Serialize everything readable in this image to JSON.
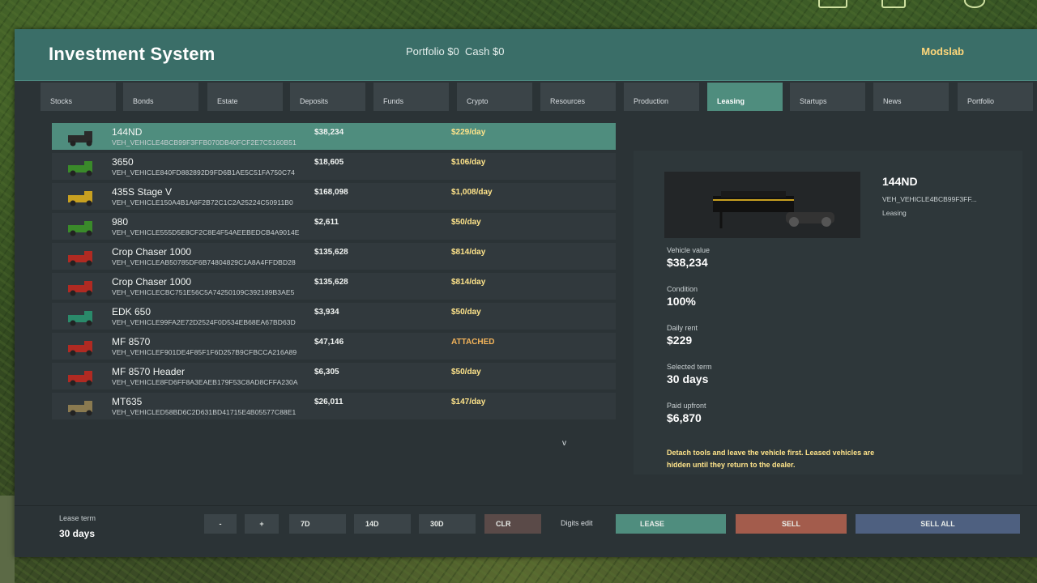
{
  "header": {
    "title": "Investment System",
    "portfolio": "Portfolio $0",
    "cash": "Cash $0",
    "brand": "Modslab"
  },
  "tabs": [
    {
      "label": "Stocks"
    },
    {
      "label": "Bonds"
    },
    {
      "label": "Estate"
    },
    {
      "label": "Deposits"
    },
    {
      "label": "Funds"
    },
    {
      "label": "Crypto"
    },
    {
      "label": "Resources"
    },
    {
      "label": "Production"
    },
    {
      "label": "Leasing"
    },
    {
      "label": "Startups"
    },
    {
      "label": "News"
    },
    {
      "label": "Portfolio"
    }
  ],
  "active_tab": "Leasing",
  "vehicles": [
    {
      "name": "144ND",
      "id": "VEH_VEHICLE4BCB99F3FFB070DB40FCF2E7C5160B51",
      "price": "$38,234",
      "rate": "$229/day",
      "thumb_color": "#2a2a2a"
    },
    {
      "name": "3650",
      "id": "VEH_VEHICLE840FD882892D9FD6B1AE5C51FA750C74",
      "price": "$18,605",
      "rate": "$106/day",
      "thumb_color": "#3a8a2a"
    },
    {
      "name": "435S Stage V",
      "id": "VEH_VEHICLE150A4B1A6F2B72C1C2A25224C50911B0",
      "price": "$168,098",
      "rate": "$1,008/day",
      "thumb_color": "#c8a020"
    },
    {
      "name": "980",
      "id": "VEH_VEHICLE555D5E8CF2C8E4F54AEEBEDCB4A9014E",
      "price": "$2,611",
      "rate": "$50/day",
      "thumb_color": "#3a8a2a"
    },
    {
      "name": "Crop Chaser 1000",
      "id": "VEH_VEHICLEAB50785DF6B74804829C1A8A4FFDBD28",
      "price": "$135,628",
      "rate": "$814/day",
      "thumb_color": "#b02a22"
    },
    {
      "name": "Crop Chaser 1000",
      "id": "VEH_VEHICLECBC751E56C5A74250109C392189B3AE5",
      "price": "$135,628",
      "rate": "$814/day",
      "thumb_color": "#b02a22"
    },
    {
      "name": "EDK 650",
      "id": "VEH_VEHICLE99FA2E72D2524F0D534EB68EA67BD63D",
      "price": "$3,934",
      "rate": "$50/day",
      "thumb_color": "#2a8a6a"
    },
    {
      "name": "MF 8570",
      "id": "VEH_VEHICLEF901DE4F85F1F6D257B9CFBCCA216A89",
      "price": "$47,146",
      "rate": "ATTACHED",
      "thumb_color": "#b02a22"
    },
    {
      "name": "MF 8570 Header",
      "id": "VEH_VEHICLE8FD6FF8A3EAEB179F53C8AD8CFFA230A",
      "price": "$6,305",
      "rate": "$50/day",
      "thumb_color": "#b02a22"
    },
    {
      "name": "MT635",
      "id": "VEH_VEHICLED58BD6C2D631BD41715E4B05577C88E1",
      "price": "$26,011",
      "rate": "$147/day",
      "thumb_color": "#8a7a50"
    }
  ],
  "scroll_arrow": "v",
  "detail": {
    "name": "144ND",
    "id_short": "VEH_VEHICLE4BCB99F3FF...",
    "status": "Leasing",
    "vehicle_value_label": "Vehicle value",
    "vehicle_value": "$38,234",
    "condition_label": "Condition",
    "condition": "100%",
    "daily_rent_label": "Daily rent",
    "daily_rent": "$229",
    "selected_term_label": "Selected term",
    "selected_term": "30 days",
    "paid_upfront_label": "Paid upfront",
    "paid_upfront": "$6,870",
    "note": "Detach tools and leave the vehicle first. Leased vehicles are hidden until they return to the dealer."
  },
  "footer": {
    "lease_term_label": "Lease term",
    "lease_term_value": "30 days",
    "minus": "-",
    "plus": "+",
    "d7": "7D",
    "d14": "14D",
    "d30": "30D",
    "clr": "CLR",
    "digits_edit": "Digits edit",
    "lease": "LEASE",
    "sell": "SELL",
    "sell_all": "SELL ALL"
  },
  "colors": {
    "header_bg": "#3a6e68",
    "accent": "#4f8d7e",
    "rate_text": "#ffe48a",
    "brand_text": "#ffd77a",
    "sell": "#a35c4c",
    "sell_all": "#4e6080"
  }
}
